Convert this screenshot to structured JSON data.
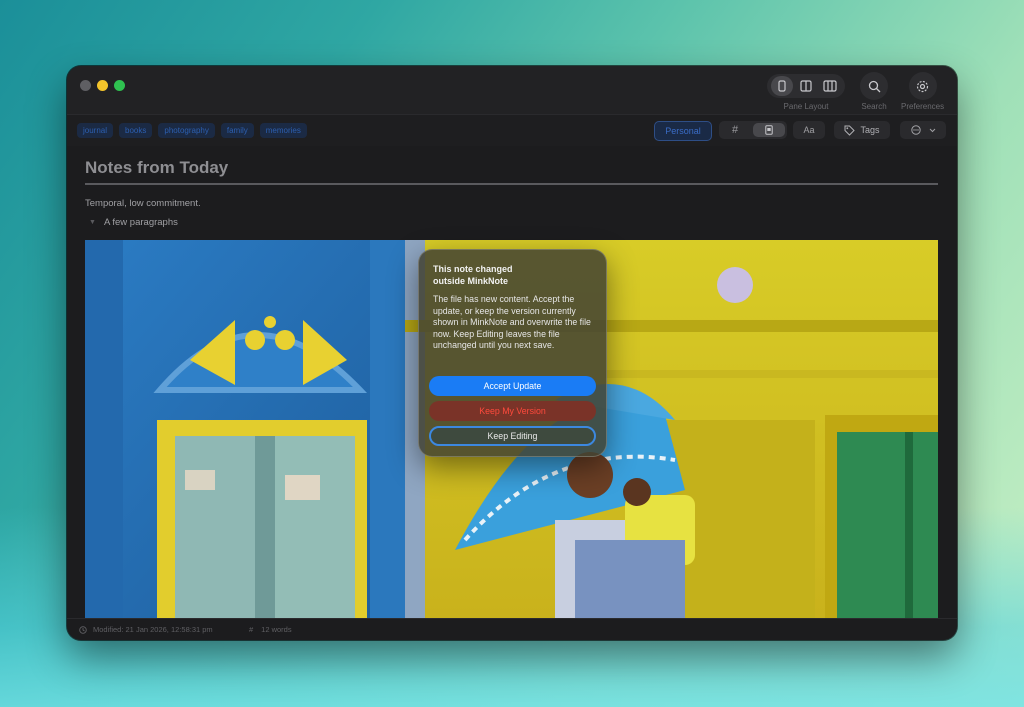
{
  "toolbar": {
    "pane_layout_label": "Pane Layout",
    "search_label": "Search",
    "preferences_label": "Preferences"
  },
  "tags": [
    "journal",
    "books",
    "photography",
    "family",
    "memories"
  ],
  "collection": {
    "label": "Personal"
  },
  "format": {
    "hash": "#",
    "aa": "Aa",
    "tags": "Tags"
  },
  "note": {
    "title": "Notes from Today",
    "line1": "Temporal, low commitment.",
    "line2": "A few paragraphs"
  },
  "status": {
    "modified": "Modified: 21 Jan 2026, 12:58:31 pm",
    "words_hash": "#",
    "words": "12 words"
  },
  "dialog": {
    "title": "This note changed outside MinkNote",
    "body": "The file has new content. Accept the update, or keep the version currently shown in MinkNote and overwrite the file now. Keep Editing leaves the file unchanged until you next save.",
    "accept": "Accept Update",
    "keep_mine": "Keep My Version",
    "keep_editing": "Keep Editing"
  },
  "colors": {
    "accent": "#1a7cf5",
    "destructive": "#ff4a3c",
    "tag_text": "#2c5fb0"
  }
}
